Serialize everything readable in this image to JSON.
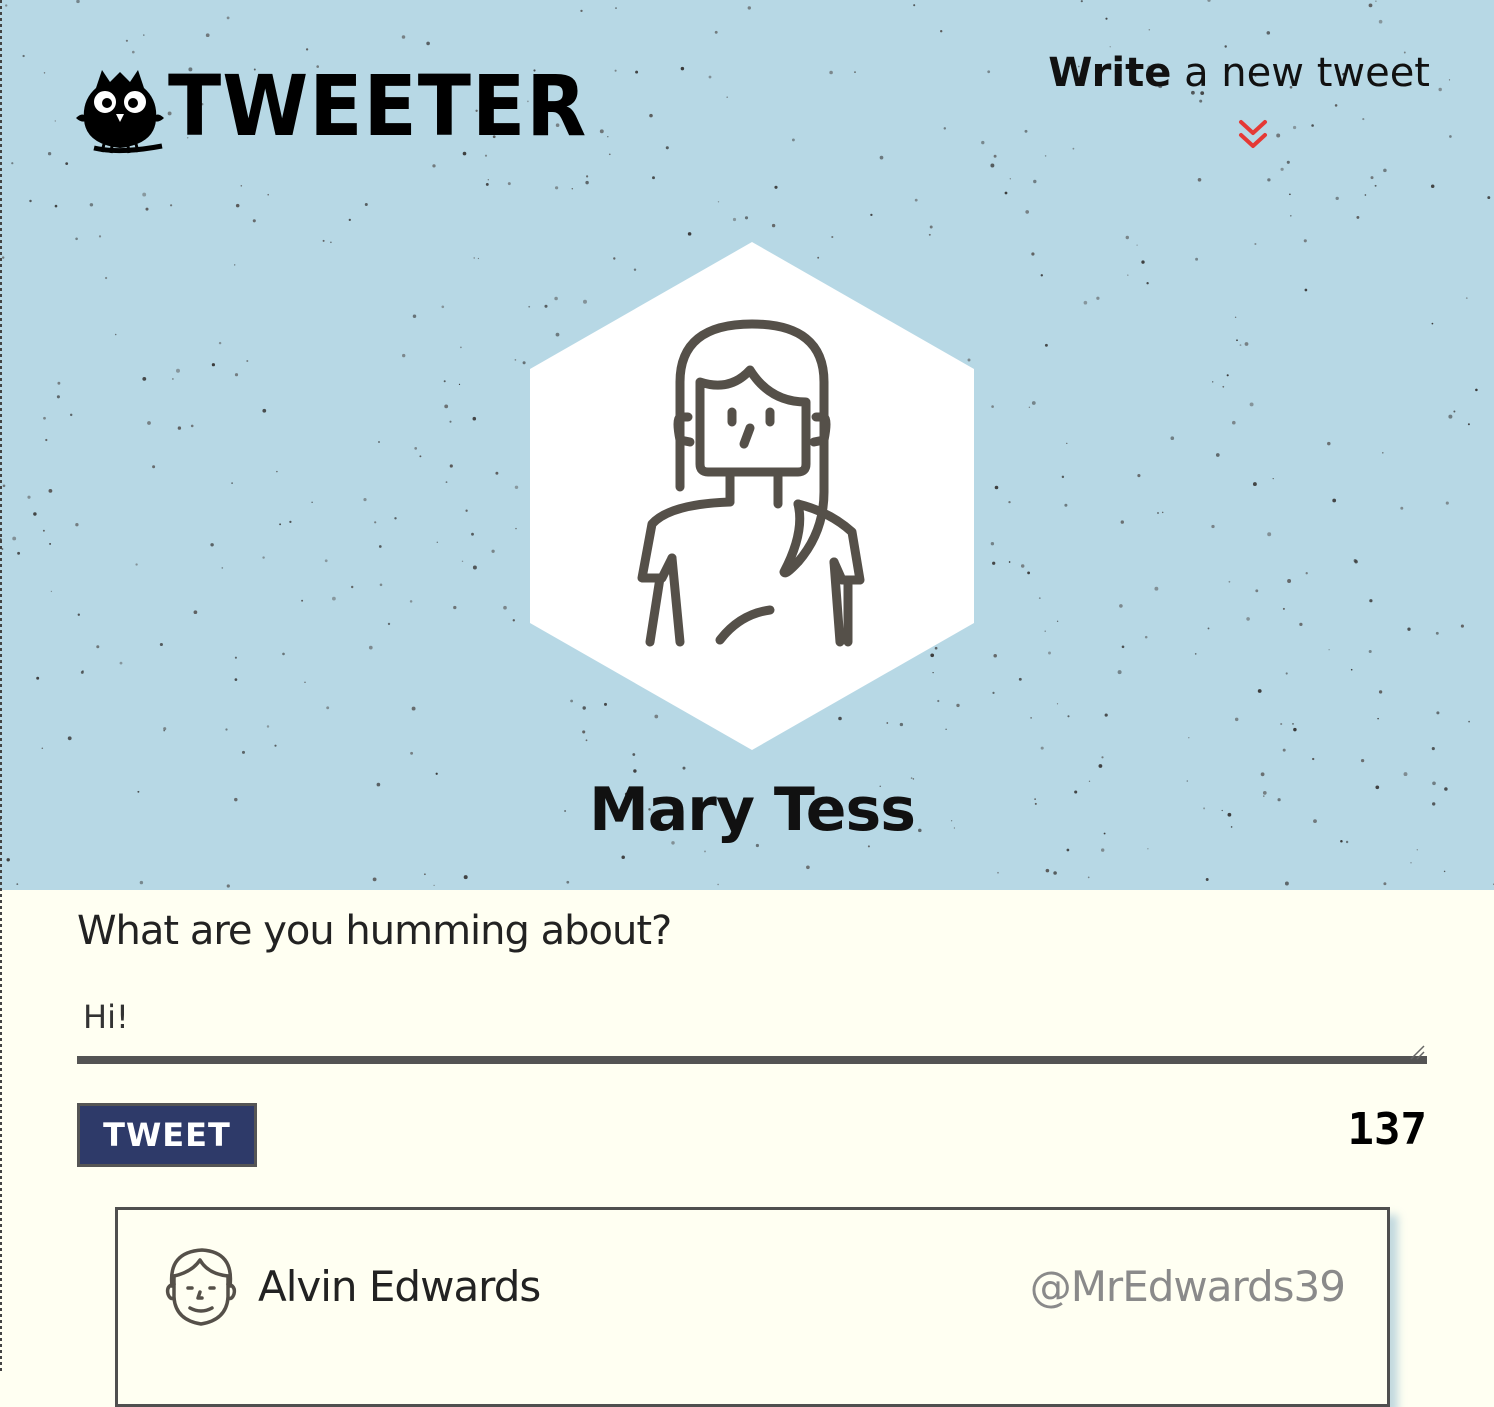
{
  "header": {
    "logo_text": "TWEETER",
    "write_prompt_strong": "Write",
    "write_prompt_rest": " a new tweet",
    "chevron_icon": "double-chevron-down-icon",
    "chevron_color": "#e53935"
  },
  "profile": {
    "name": "Mary Tess",
    "avatar_icon": "woman-avatar-icon"
  },
  "composer": {
    "label": "What are you humming about?",
    "value": "Hi!",
    "button_label": "TWEET",
    "char_count": "137"
  },
  "tweets": [
    {
      "avatar_icon": "man-avatar-icon",
      "name": "Alvin Edwards",
      "handle": "@MrEdwards39"
    }
  ],
  "colors": {
    "hero_background": "#b7d8e5",
    "page_background": "#fffff2",
    "button_background": "#2e3a69",
    "accent": "#e53935"
  }
}
